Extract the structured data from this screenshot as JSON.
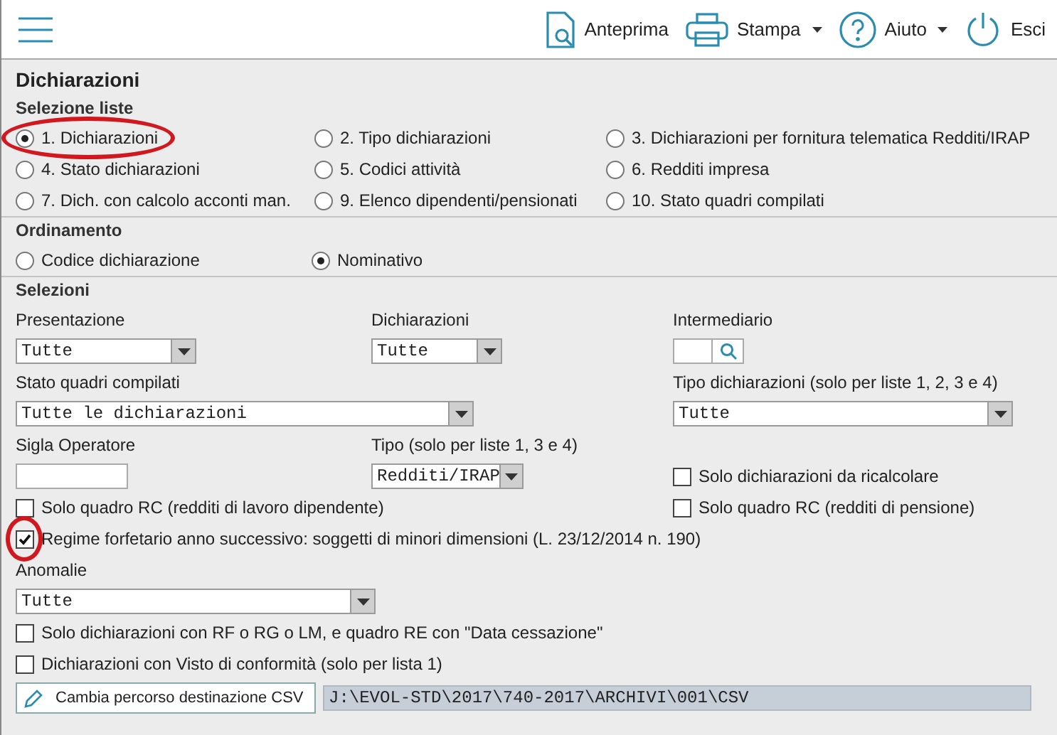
{
  "toolbar": {
    "actions": [
      {
        "kind": "preview",
        "label": "Anteprima",
        "dropdown": false
      },
      {
        "kind": "print",
        "label": "Stampa",
        "dropdown": true
      },
      {
        "kind": "help",
        "label": "Aiuto",
        "dropdown": true
      },
      {
        "kind": "exit",
        "label": "Esci",
        "dropdown": false
      }
    ]
  },
  "title": "Dichiarazioni",
  "selezione_liste": {
    "heading": "Selezione liste",
    "options": [
      {
        "label": "1. Dichiarazioni",
        "selected": true,
        "highlighted": true
      },
      {
        "label": "2. Tipo dichiarazioni",
        "selected": false,
        "highlighted": false
      },
      {
        "label": "3. Dichiarazioni per fornitura telematica Redditi/IRAP",
        "selected": false,
        "highlighted": false
      },
      {
        "label": "4. Stato dichiarazioni",
        "selected": false,
        "highlighted": false
      },
      {
        "label": "5. Codici attività",
        "selected": false,
        "highlighted": false
      },
      {
        "label": "6. Redditi impresa",
        "selected": false,
        "highlighted": false
      },
      {
        "label": "7. Dich. con calcolo acconti man.",
        "selected": false,
        "highlighted": false
      },
      {
        "label": "9. Elenco dipendenti/pensionati",
        "selected": false,
        "highlighted": false
      },
      {
        "label": "10. Stato quadri compilati",
        "selected": false,
        "highlighted": false
      }
    ]
  },
  "ordinamento": {
    "heading": "Ordinamento",
    "options": [
      {
        "label": "Codice dichiarazione",
        "selected": false
      },
      {
        "label": "Nominativo",
        "selected": true
      }
    ]
  },
  "selezioni": {
    "heading": "Selezioni",
    "presentazione": {
      "label": "Presentazione",
      "value": "Tutte"
    },
    "dichiarazioni": {
      "label": "Dichiarazioni",
      "value": "Tutte"
    },
    "intermediario": {
      "label": "Intermediario"
    },
    "stato_quadri": {
      "label": "Stato quadri compilati",
      "value": "Tutte le dichiarazioni"
    },
    "tipo_dichiarazioni": {
      "label": "Tipo dichiarazioni (solo per liste 1, 2, 3 e 4)",
      "value": "Tutte"
    },
    "sigla_operatore": {
      "label": "Sigla Operatore"
    },
    "tipo": {
      "label": "Tipo (solo per liste 1, 3 e 4)",
      "value": "Redditi/IRAP"
    },
    "ricalcolare": {
      "label": "Solo dichiarazioni da ricalcolare",
      "checked": false,
      "highlighted": false
    },
    "rc_dipendente": {
      "label": "Solo quadro RC (redditi di lavoro dipendente)",
      "checked": false,
      "highlighted": false
    },
    "rc_pensione": {
      "label": "Solo quadro RC (redditi di pensione)",
      "checked": false,
      "highlighted": false
    },
    "regime_forfetario": {
      "label": "Regime forfetario anno successivo: soggetti di minori dimensioni (L. 23/12/2014 n. 190)",
      "checked": true,
      "highlighted": true
    },
    "anomalie": {
      "label": "Anomalie",
      "value": "Tutte"
    },
    "cessazione": {
      "label": "Solo dichiarazioni con RF o RG o LM, e quadro RE con \"Data cessazione\"",
      "checked": false,
      "highlighted": false
    },
    "visto": {
      "label": "Dichiarazioni con Visto di conformità (solo per lista 1)",
      "checked": false,
      "highlighted": false
    },
    "csv_button": "Cambia percorso destinazione CSV",
    "csv_path": "J:\\EVOL-STD\\2017\\740-2017\\ARCHIVI\\001\\CSV"
  }
}
